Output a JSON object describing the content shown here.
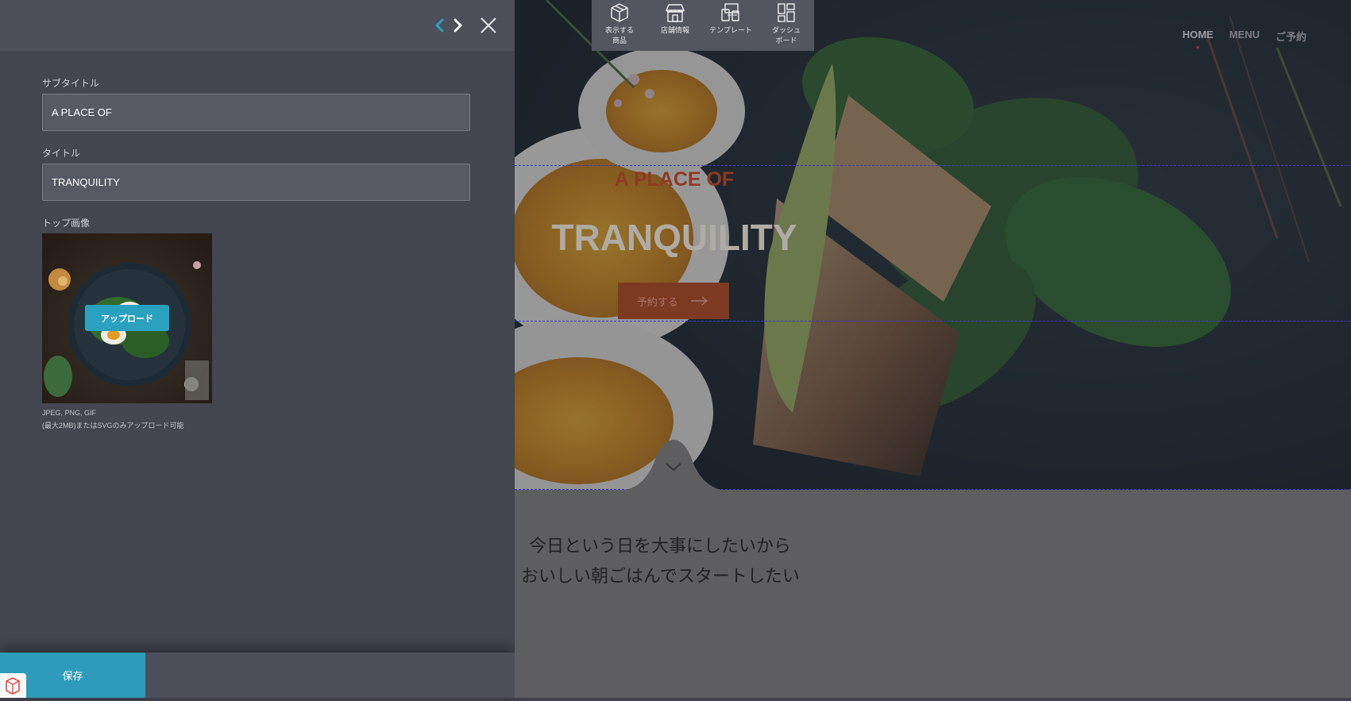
{
  "editor": {
    "fields": {
      "subtitle": {
        "label": "サブタイトル",
        "value": "A PLACE OF"
      },
      "title": {
        "label": "タイトル",
        "value": "TRANQUILITY"
      },
      "top_image": {
        "label": "トップ画像",
        "upload_label": "アップロード"
      }
    },
    "hints": {
      "line1": "JPEG, PNG, GIF",
      "line2": "(最大2MB)またはSVGのみアップロード可能"
    },
    "save_label": "保存",
    "accent_color": "#2aa1bf"
  },
  "toolbar": {
    "items": [
      {
        "label": "表示する\n商品",
        "icon": "box-icon"
      },
      {
        "label": "店舗情報",
        "icon": "store-icon"
      },
      {
        "label": "テンプレート",
        "icon": "devices-icon"
      },
      {
        "label": "ダッシュ\nボード",
        "icon": "dashboard-icon"
      }
    ]
  },
  "preview": {
    "nav": {
      "items": [
        "HOME",
        "MENU",
        "ご予約"
      ],
      "active": "HOME"
    },
    "hero": {
      "subtitle": "A PLACE OF",
      "title": "TRANQUILITY",
      "reserve_label": "予約する"
    },
    "message": {
      "line1": "今日という日を大事にしたいから",
      "line2": "おいしい朝ごはんでスタートしたい"
    }
  }
}
